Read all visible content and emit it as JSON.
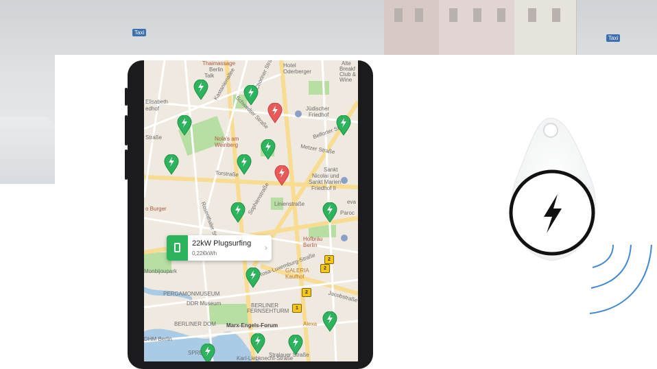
{
  "background": {
    "taxi_sign_left": "Taxi",
    "taxi_sign_right": "Taxi"
  },
  "map": {
    "labels": {
      "thaimassage": "Thaimassage",
      "berlin_top": "Berlin",
      "dtalk": "Talk",
      "hotel": "Hotel",
      "odderberger": "Oderberger",
      "alte_breakfast": "Alte",
      "breakfast": "Breakf",
      "club": "Club &",
      "wine": "Wine",
      "elisabeth": "Elisabeth",
      "friedhof_left": "edhof",
      "juedischer": "Jüdischer",
      "friedhof_j": "Friedhof",
      "kastanienallee": "Kastanienallee",
      "schwedter": "Schwedter Straße",
      "choriner": "Choriner Straße",
      "nolas": "Nola's am",
      "weinberg": "Weinberg",
      "strasse_left": "Straße",
      "metzer": "Metzer Straße",
      "belforter": "Belforter Straße",
      "torstrasse": "Torstraße",
      "sankt": "Sankt",
      "nicolai": "Nicolai und",
      "sankt_marien": "Sankt Marien",
      "friedhof_ii": "Friedhof II",
      "burger": "o Burger",
      "linienstrasse": "Linienstraße",
      "rosenthaler": "Rosenthaler Straße",
      "paroc": "Paroc",
      "eva": "eva",
      "sophienstrasse": "Sophienstraße",
      "hofbraeu": "Hofbräu",
      "berlin_hof": "Berlin",
      "rosa_lux": "Rosa-Luxemburg-Straße",
      "monbijoupark": "Monbijoupark",
      "galeria": "GALERIA",
      "kaufhof": "Kaufhof",
      "pergamon": "PERGAMONMUSEUM",
      "ddr": "DDR Museum",
      "berliner": "BERLINER",
      "fernsehturm": "FERNSEHTURM",
      "jacobstrasse": "Jacobstraße",
      "berliner_dom": "BERLINER DOM",
      "marx_engels": "Marx-Engels-Forum",
      "alexa": "Alexa",
      "dhm": "DHM Berlin",
      "spree": "SPREE",
      "stralauer": "Stralauer Straße",
      "karl_lieb": "Karl-Liebknecht-Straße"
    },
    "badges": [
      "2",
      "2",
      "1",
      "2"
    ],
    "colors": {
      "charger_green": "#2db35d",
      "busy_red": "#e8595a",
      "map_bg": "#efe9df",
      "park": "#b7dea3",
      "road": "#f7dc92"
    }
  },
  "card": {
    "title": "22kW Plugsurfing",
    "price": "0,22€kWh",
    "chevron": "›",
    "icon": "phone-plug-icon"
  },
  "tag": {
    "icon": "lightning-bolt-icon",
    "signal": "nfc-waves-icon"
  }
}
